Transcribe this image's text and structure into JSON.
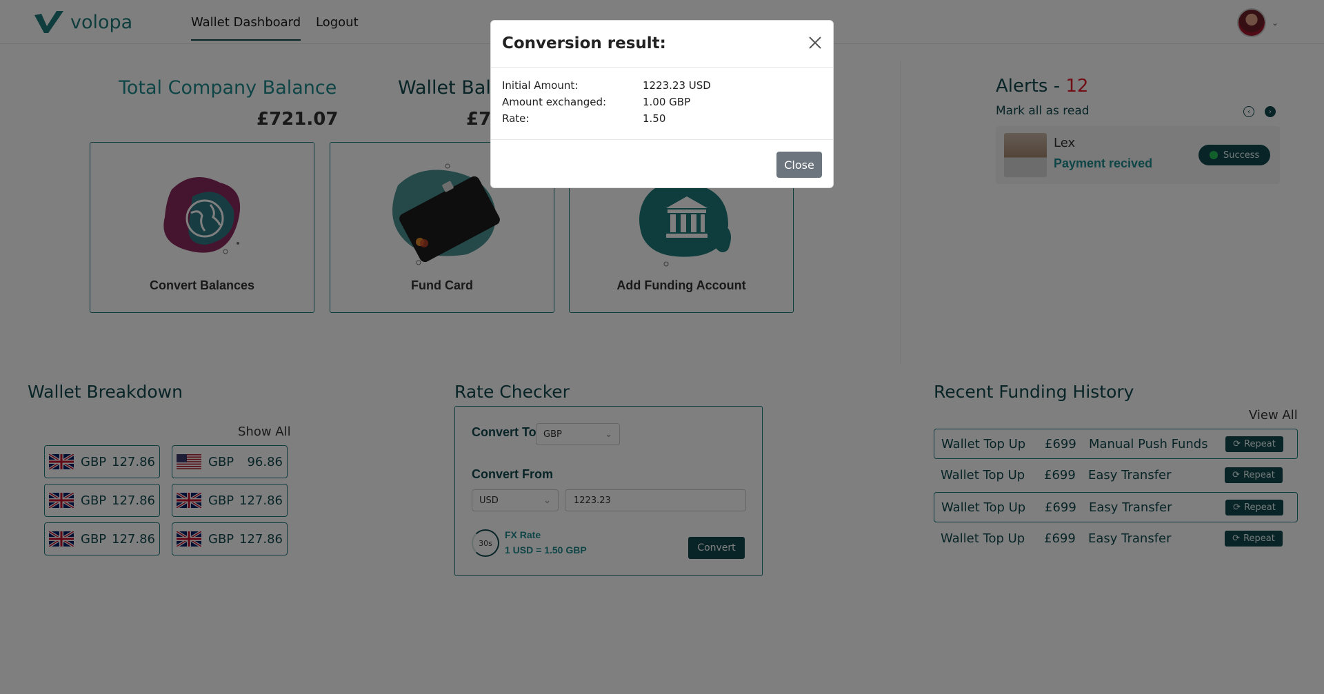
{
  "app": {
    "logo_text": "volopa"
  },
  "nav": {
    "dashboard": "Wallet Dashboard",
    "logout": "Logout"
  },
  "balances": {
    "company_title": "Total Company Balance",
    "company_amount": "£721.07",
    "wallet_title": "Wallet Bal",
    "wallet_amount": "£7"
  },
  "actions": {
    "convert": "Convert Balances",
    "fund": "Fund Card",
    "add_account": "Add Funding Account"
  },
  "alerts": {
    "title": "Alerts - ",
    "count": "12",
    "mark_read": "Mark all as read",
    "items": [
      {
        "name": "Lex",
        "message": "Payment recived",
        "status": "Success"
      }
    ]
  },
  "wallet_breakdown": {
    "title": "Wallet Breakdown",
    "show_all": "Show All",
    "items": [
      {
        "flag": "uk-flag-icon",
        "currency": "GBP",
        "amount": "127.86"
      },
      {
        "flag": "us-flag-icon",
        "currency": "GBP",
        "amount": "96.86"
      },
      {
        "flag": "uk-flag-icon",
        "currency": "GBP",
        "amount": "127.86"
      },
      {
        "flag": "uk-flag-icon",
        "currency": "GBP",
        "amount": "127.86"
      },
      {
        "flag": "uk-flag-icon",
        "currency": "GBP",
        "amount": "127.86"
      },
      {
        "flag": "uk-flag-icon",
        "currency": "GBP",
        "amount": "127.86"
      }
    ]
  },
  "rate_checker": {
    "title": "Rate Checker",
    "convert_to_label": "Convert To",
    "convert_to_value": "GBP",
    "convert_from_label": "Convert From",
    "convert_from_currency": "USD",
    "convert_from_amount": "1223.23",
    "timer": "30s",
    "fx_label": "FX Rate",
    "fx_value": "1 USD = 1.50 GBP",
    "convert_button": "Convert"
  },
  "funding_history": {
    "title": "Recent Funding History",
    "view_all": "View All",
    "repeat_label": "Repeat",
    "rows": [
      {
        "type": "Wallet Top Up",
        "amount": "£699",
        "method": "Manual Push Funds"
      },
      {
        "type": "Wallet Top Up",
        "amount": "£699",
        "method": "Easy Transfer"
      },
      {
        "type": "Wallet Top Up",
        "amount": "£699",
        "method": "Easy Transfer"
      },
      {
        "type": "Wallet Top Up",
        "amount": "£699",
        "method": "Easy Transfer"
      }
    ]
  },
  "modal": {
    "title": "Conversion result:",
    "rows": [
      {
        "label": "Initial Amount:",
        "value": "1223.23 USD"
      },
      {
        "label": "Amount exchanged:",
        "value": "1.00 GBP"
      },
      {
        "label": "Rate:",
        "value": "1.50"
      }
    ],
    "close_button": "Close"
  },
  "colors": {
    "primary": "#11494e",
    "accent": "#1f8a8c",
    "alert_count": "#e0202c",
    "overlay": "rgba(0,0,0,0.5)"
  }
}
